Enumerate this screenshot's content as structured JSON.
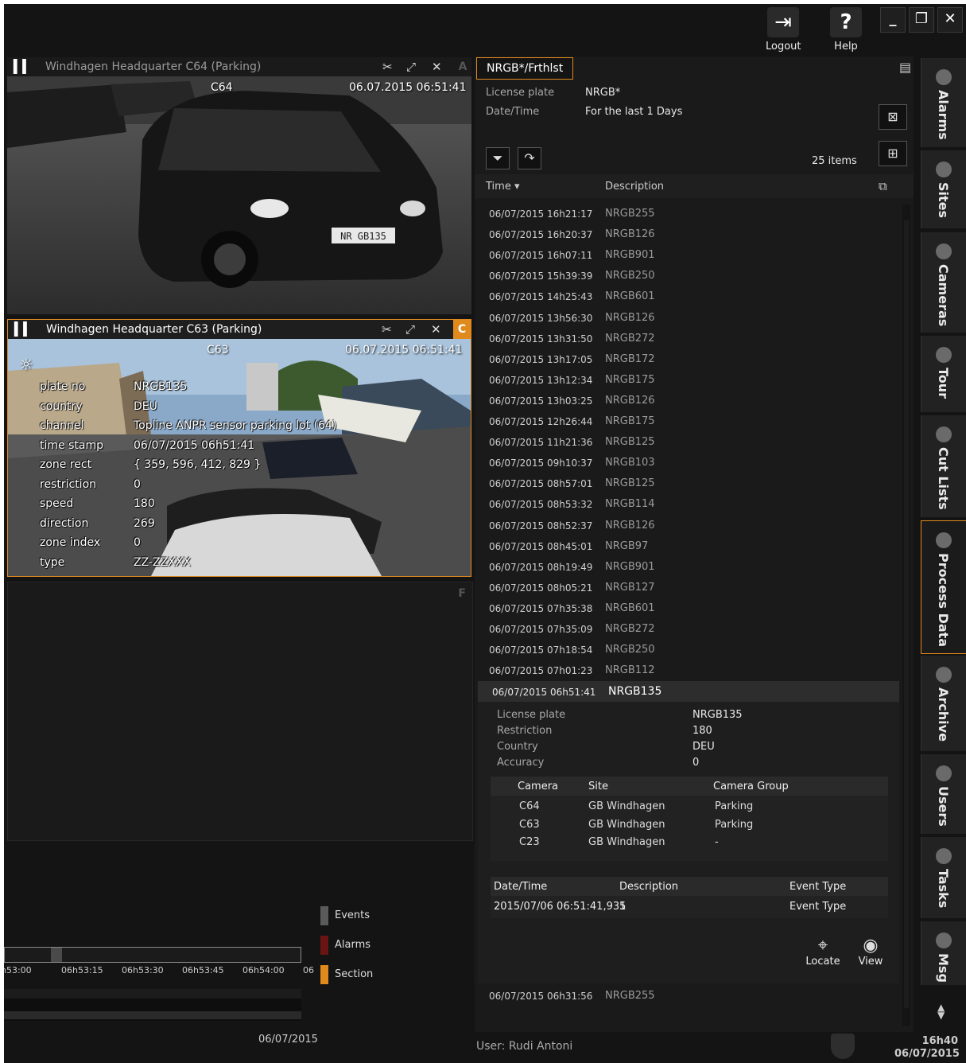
{
  "topbar": {
    "logout_label": "Logout",
    "help_label": "Help"
  },
  "panes": {
    "a": {
      "title": "Windhagen Headquarter C64 (Parking)",
      "letter": "A",
      "cam_label": "C64",
      "timestamp": "06.07.2015 06:51:41",
      "plate_text": "NR GB135"
    },
    "c": {
      "title": "Windhagen Headquarter C63 (Parking)",
      "letter": "C",
      "cam_label": "C63",
      "timestamp": "06.07.2015 06:51:41",
      "metadata": [
        {
          "k": "plate no",
          "v": "NRGB135"
        },
        {
          "k": "country",
          "v": "DEU"
        },
        {
          "k": "channel",
          "v": "Topline ANPR sensor parking lot (64)"
        },
        {
          "k": "time stamp",
          "v": "06/07/2015 06h51:41"
        },
        {
          "k": "zone rect",
          "v": "{ 359, 596, 412, 829 }"
        },
        {
          "k": "restriction",
          "v": "0"
        },
        {
          "k": "speed",
          "v": "180"
        },
        {
          "k": "direction",
          "v": "269"
        },
        {
          "k": "zone index",
          "v": "0"
        },
        {
          "k": "type",
          "v": "ZZ-ZZXXX"
        }
      ]
    },
    "f": {
      "letter": "F"
    }
  },
  "timeline": {
    "legend": [
      "Events",
      "Alarms",
      "Section"
    ],
    "legend_colors": [
      "#5a5a5a",
      "#6b1414",
      "#e08a1e"
    ],
    "ticks": [
      "h53:00",
      "06h53:15",
      "06h53:30",
      "06h53:45",
      "06h54:00",
      "06"
    ],
    "date": "06/07/2015"
  },
  "search": {
    "tab": "NRGB*/Frthlst",
    "license_plate_label": "License plate",
    "license_plate_value": "NRGB*",
    "datetime_label": "Date/Time",
    "datetime_value": "For the last 1 Days",
    "count": "25 items",
    "col_time": "Time ▾",
    "col_description": "Description"
  },
  "rows": [
    {
      "t": "06/07/2015 16h21:17",
      "d": "NRGB255"
    },
    {
      "t": "06/07/2015 16h20:37",
      "d": "NRGB126"
    },
    {
      "t": "06/07/2015 16h07:11",
      "d": "NRGB901"
    },
    {
      "t": "06/07/2015 15h39:39",
      "d": "NRGB250"
    },
    {
      "t": "06/07/2015 14h25:43",
      "d": "NRGB601"
    },
    {
      "t": "06/07/2015 13h56:30",
      "d": "NRGB126"
    },
    {
      "t": "06/07/2015 13h31:50",
      "d": "NRGB272"
    },
    {
      "t": "06/07/2015 13h17:05",
      "d": "NRGB172"
    },
    {
      "t": "06/07/2015 13h12:34",
      "d": "NRGB175"
    },
    {
      "t": "06/07/2015 13h03:25",
      "d": "NRGB126"
    },
    {
      "t": "06/07/2015 12h26:44",
      "d": "NRGB175"
    },
    {
      "t": "06/07/2015 11h21:36",
      "d": "NRGB125"
    },
    {
      "t": "06/07/2015 09h10:37",
      "d": "NRGB103"
    },
    {
      "t": "06/07/2015 08h57:01",
      "d": "NRGB125"
    },
    {
      "t": "06/07/2015 08h53:32",
      "d": "NRGB114"
    },
    {
      "t": "06/07/2015 08h52:37",
      "d": "NRGB126"
    },
    {
      "t": "06/07/2015 08h45:01",
      "d": "NRGB97"
    },
    {
      "t": "06/07/2015 08h19:49",
      "d": "NRGB901"
    },
    {
      "t": "06/07/2015 08h05:21",
      "d": "NRGB127"
    },
    {
      "t": "06/07/2015 07h35:38",
      "d": "NRGB601"
    },
    {
      "t": "06/07/2015 07h35:09",
      "d": "NRGB272"
    },
    {
      "t": "06/07/2015 07h18:54",
      "d": "NRGB250"
    },
    {
      "t": "06/07/2015 07h01:23",
      "d": "NRGB112"
    }
  ],
  "expanded": {
    "t": "06/07/2015 06h51:41",
    "d": "NRGB135",
    "fields": [
      {
        "k": "License plate",
        "v": "NRGB135"
      },
      {
        "k": "Restriction",
        "v": "180"
      },
      {
        "k": "Country",
        "v": "DEU"
      },
      {
        "k": "Accuracy",
        "v": "0"
      }
    ],
    "cam_headers": [
      "Camera",
      "Site",
      "Camera Group"
    ],
    "cameras": [
      {
        "c": "C64",
        "s": "GB Windhagen",
        "g": "Parking"
      },
      {
        "c": "C63",
        "s": "GB Windhagen",
        "g": "Parking"
      },
      {
        "c": "C23",
        "s": "GB Windhagen",
        "g": "-"
      }
    ],
    "ev_headers": [
      "Date/Time",
      "Description",
      "Event Type"
    ],
    "event": {
      "dt": "2015/07/06 06:51:41,931",
      "desc": "5",
      "type": "Event Type"
    },
    "locate_label": "Locate",
    "view_label": "View"
  },
  "last_row": {
    "t": "06/07/2015 06h31:56",
    "d": "NRGB255"
  },
  "status": {
    "user": "User: Rudi Antoni",
    "time": "16h40",
    "date": "06/07/2015"
  },
  "sidetabs": [
    "Alarms",
    "Sites",
    "Cameras",
    "Tour",
    "Cut Lists",
    "Process Data",
    "Archive",
    "Users",
    "Tasks",
    "Msg"
  ]
}
